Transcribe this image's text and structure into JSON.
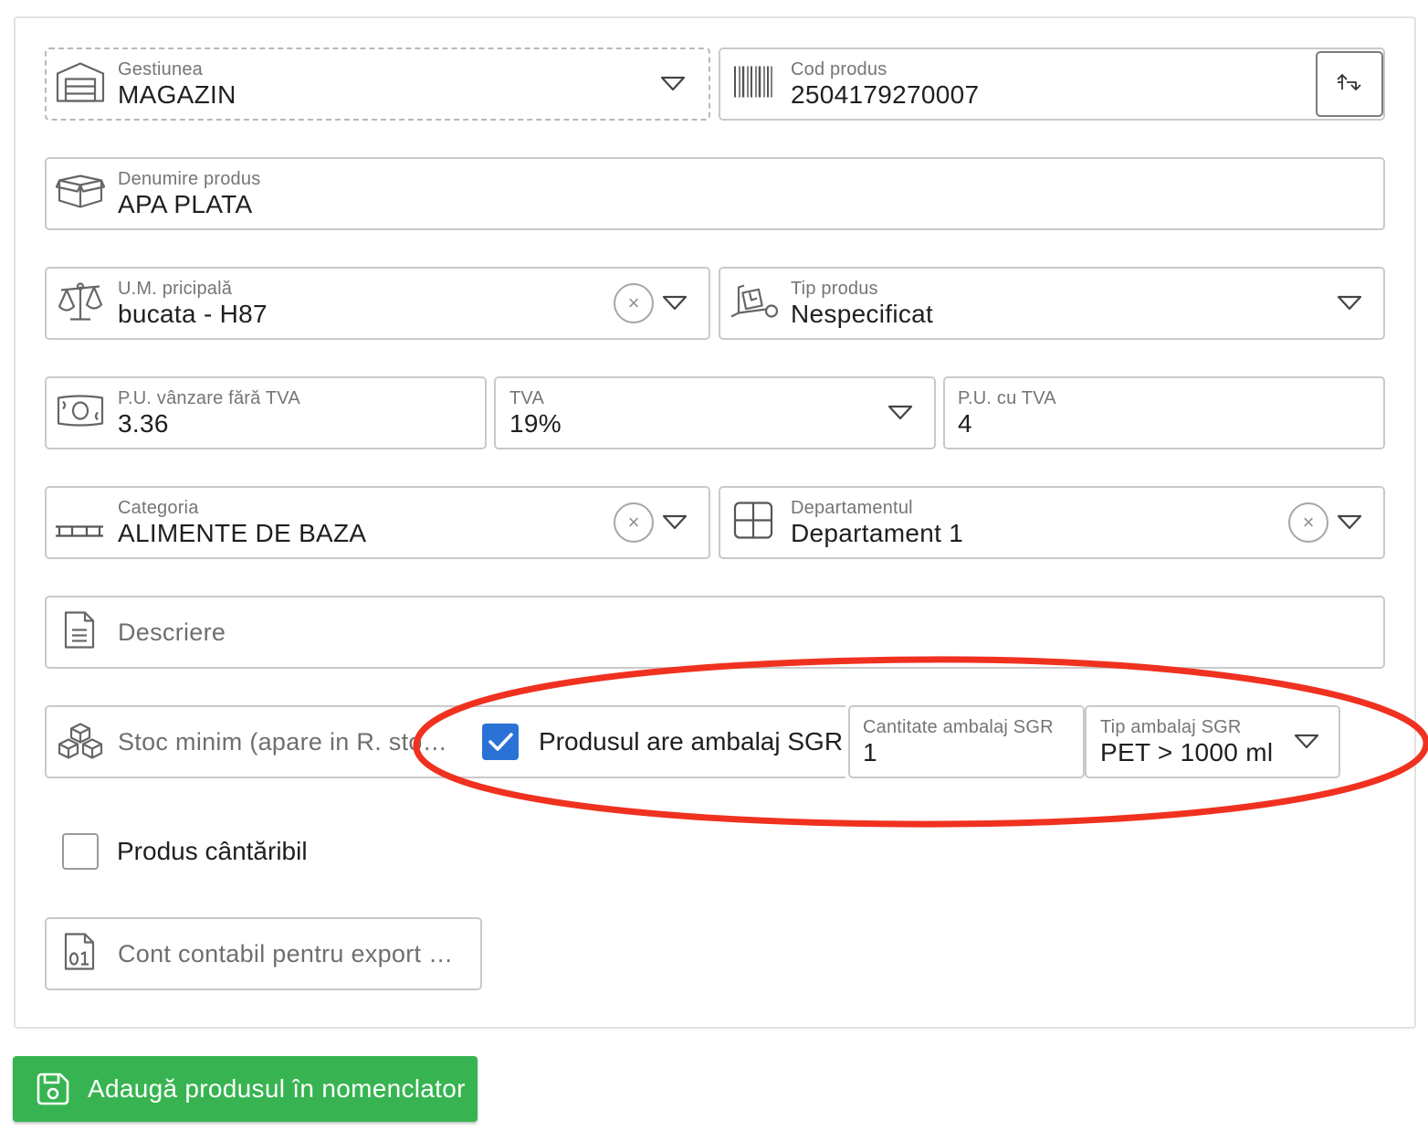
{
  "form": {
    "gestiune": {
      "label": "Gestiunea",
      "value": "MAGAZIN",
      "icon": "warehouse-icon"
    },
    "cod_produs": {
      "label": "Cod produs",
      "value": "2504179270007",
      "icon": "barcode-icon",
      "swap_icon": "swap-arrows-icon"
    },
    "denumire": {
      "label": "Denumire produs",
      "value": "APA PLATA",
      "icon": "box-icon"
    },
    "um": {
      "label": "U.M. pricipală",
      "value": "bucata - H87",
      "icon": "scale-icon",
      "clear_glyph": "×"
    },
    "tip_produs": {
      "label": "Tip produs",
      "value": "Nespecificat",
      "icon": "hand-truck-icon"
    },
    "pu_fara_tva": {
      "label": "P.U. vânzare fără TVA",
      "value": "3.36",
      "icon": "money-bill-icon"
    },
    "tva": {
      "label": "TVA",
      "value": "19%"
    },
    "pu_cu_tva": {
      "label": "P.U. cu TVA",
      "value": "4"
    },
    "categoria": {
      "label": "Categoria",
      "value": "ALIMENTE DE BAZA",
      "icon": "shelf-icon",
      "clear_glyph": "×"
    },
    "departament": {
      "label": "Departamentul",
      "value": "Departament 1",
      "icon": "grid-icon",
      "clear_glyph": "×"
    },
    "descriere": {
      "placeholder": "Descriere",
      "icon": "document-icon"
    },
    "stoc_minim": {
      "placeholder": "Stoc minim (apare in R. sto…",
      "icon": "boxes-icon"
    },
    "sgr": {
      "checkbox_label": "Produsul are ambalaj SGR",
      "checked": true,
      "cantitate": {
        "label": "Cantitate ambalaj SGR",
        "value": "1"
      },
      "tip": {
        "label": "Tip ambalaj SGR",
        "value": "PET > 1000 ml"
      }
    },
    "cantaribil": {
      "checkbox_label": "Produs cântăribil",
      "checked": false
    },
    "cont_contabil": {
      "placeholder": "Cont contabil pentru export …",
      "icon": "binary-file-icon"
    }
  },
  "actions": {
    "add_label": "Adaugă produsul în nomenclator",
    "add_icon": "save-icon",
    "color": "#37b451"
  },
  "annotation": {
    "color": "#f0311f",
    "shape": "ellipse"
  },
  "accent": "#2a72d6"
}
